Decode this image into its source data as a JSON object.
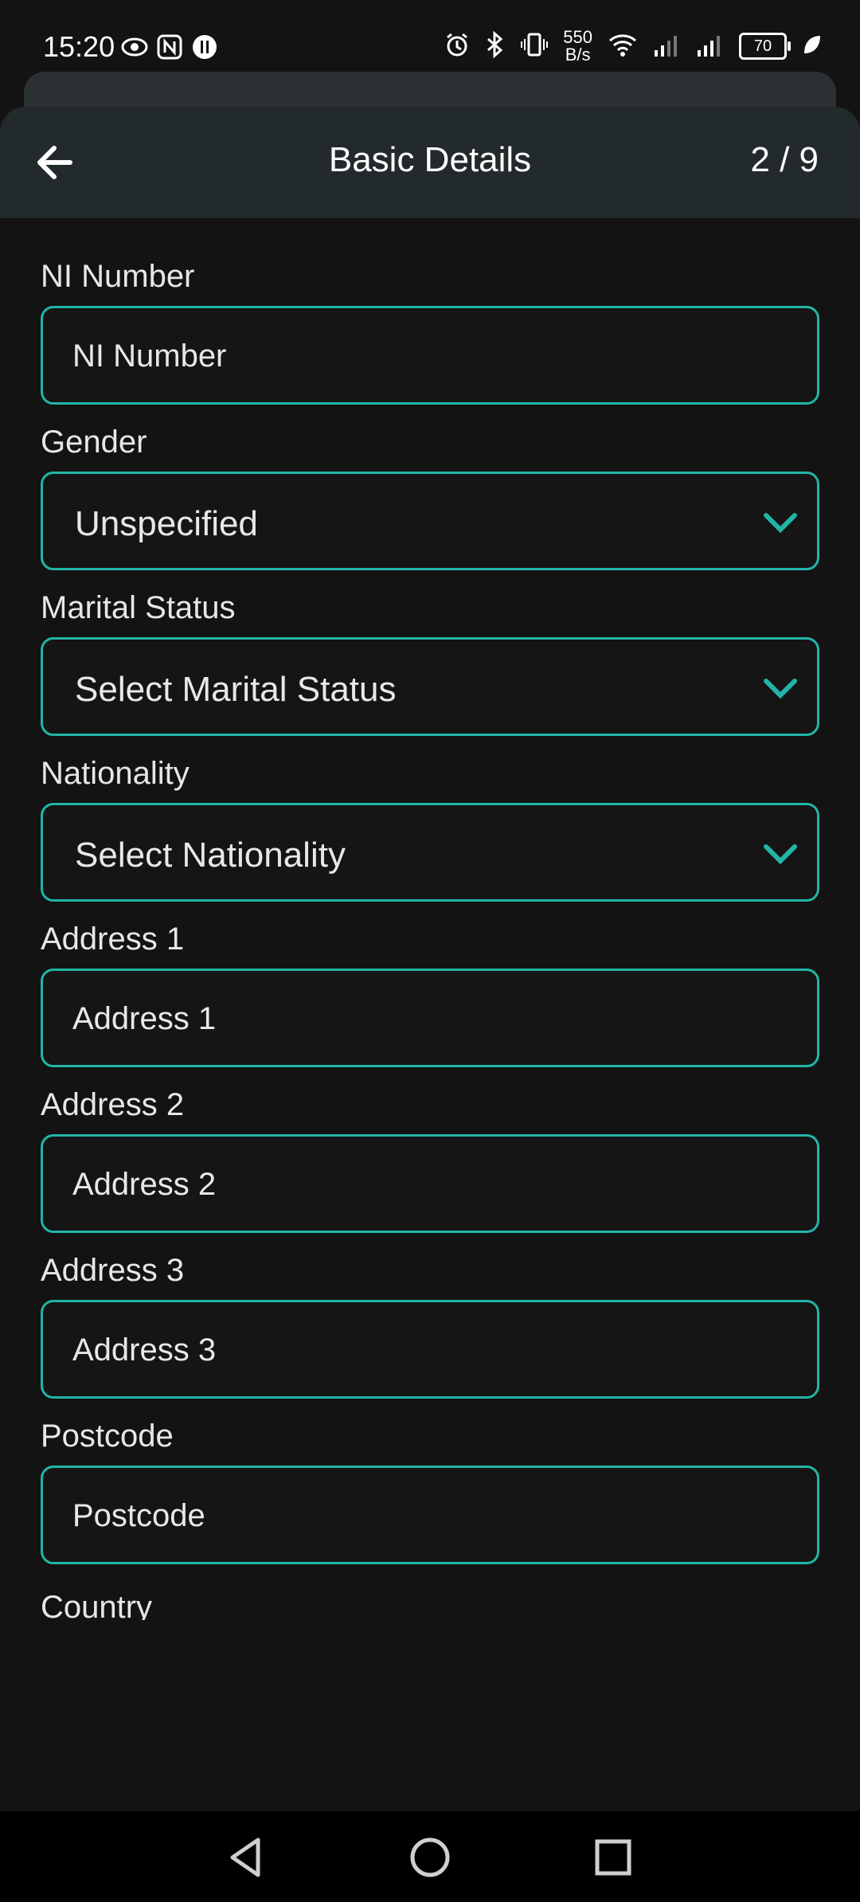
{
  "status_bar": {
    "time": "15:20",
    "speed_top": "550",
    "speed_bottom": "B/s",
    "battery": "70"
  },
  "header": {
    "title": "Basic Details",
    "step": "2 / 9"
  },
  "form": {
    "ni": {
      "label": "NI Number",
      "placeholder": "NI Number"
    },
    "gender": {
      "label": "Gender",
      "value": "Unspecified"
    },
    "marital": {
      "label": "Marital Status",
      "value": "Select Marital Status"
    },
    "nationality": {
      "label": "Nationality",
      "value": "Select Nationality"
    },
    "address1": {
      "label": "Address 1",
      "placeholder": "Address 1"
    },
    "address2": {
      "label": "Address 2",
      "placeholder": "Address 2"
    },
    "address3": {
      "label": "Address 3",
      "placeholder": "Address 3"
    },
    "postcode": {
      "label": "Postcode",
      "placeholder": "Postcode"
    },
    "country": {
      "label": "Country"
    }
  },
  "colors": {
    "accent": "#21b5a8",
    "background": "#131313",
    "header": "#232a2b"
  }
}
